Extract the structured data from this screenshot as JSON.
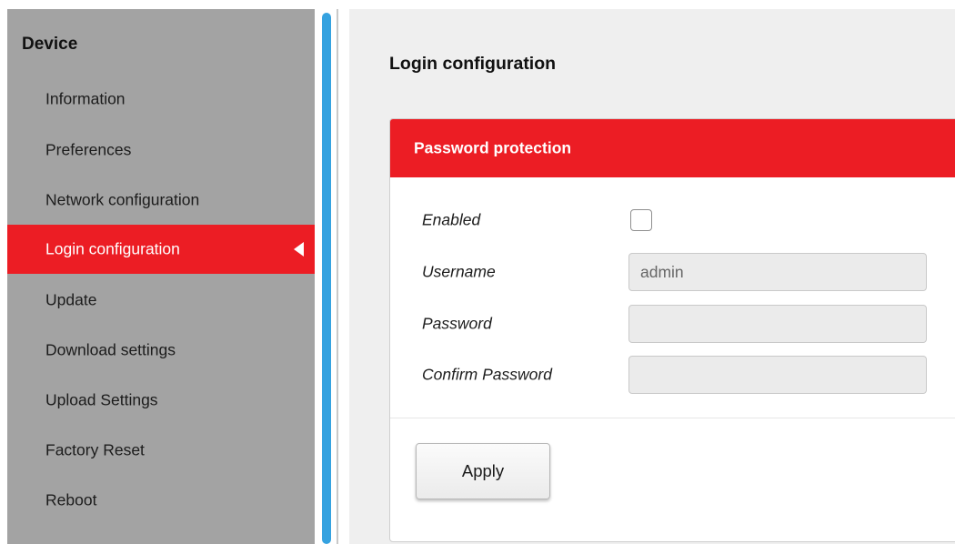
{
  "sidebar": {
    "heading": "Device",
    "items": [
      {
        "label": "Information",
        "active": false
      },
      {
        "label": "Preferences",
        "active": false
      },
      {
        "label": "Network configuration",
        "active": false
      },
      {
        "label": "Login configuration",
        "active": true
      },
      {
        "label": "Update",
        "active": false
      },
      {
        "label": "Download settings",
        "active": false
      },
      {
        "label": "Upload Settings",
        "active": false
      },
      {
        "label": "Factory Reset",
        "active": false
      },
      {
        "label": "Reboot",
        "active": false
      }
    ]
  },
  "main": {
    "title": "Login configuration",
    "card": {
      "header_title": "Password protection",
      "fields": {
        "enabled": {
          "label": "Enabled",
          "checked": false
        },
        "username": {
          "label": "Username",
          "value": "admin",
          "placeholder": ""
        },
        "password": {
          "label": "Password",
          "value": "",
          "placeholder": ""
        },
        "confirm_password": {
          "label": "Confirm Password",
          "value": "",
          "placeholder": ""
        }
      },
      "apply_label": "Apply"
    }
  },
  "colors": {
    "accent": "#ec1d24",
    "sidebar_bg": "#a3a3a3",
    "scroll_thumb": "#35a2e0",
    "main_bg": "#efefef"
  }
}
